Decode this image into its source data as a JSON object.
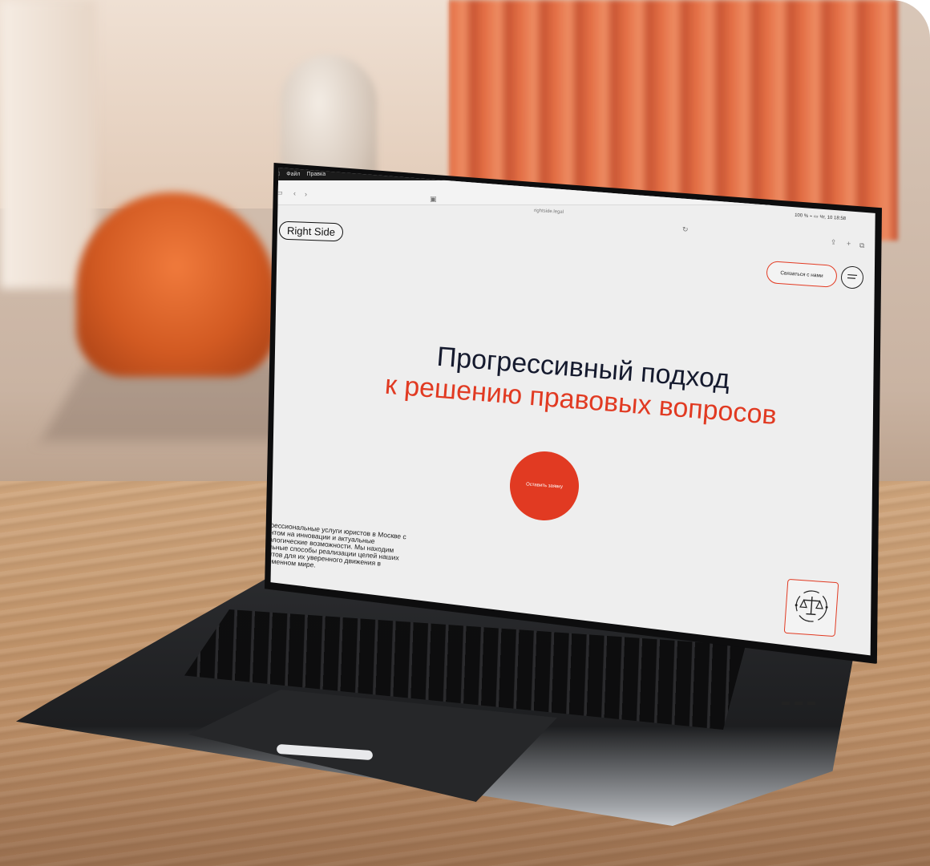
{
  "menubar": {
    "apple_icon": "apple-icon",
    "items": [
      "Файл",
      "Правка"
    ]
  },
  "browser": {
    "url": "rightside.legal",
    "status": "100 %  ⌁  ▭  Чт, 10  18:58"
  },
  "site": {
    "logo": "Right Side",
    "contact_button": "Связаться с нами",
    "menu_icon": "menu-icon",
    "headline_line1": "Прогрессивный подход",
    "headline_line2": "к решению правовых вопросов",
    "cta_label": "Оставить заявку",
    "description": "Профессиональные услуги юристов в Москве с акцентом на инновации и актуальные технологические возможности. Мы находим легальные способы реализации целей наших клиентов для их уверенного движения в современном мире.",
    "badge_icon": "scales-icon"
  },
  "colors": {
    "accent": "#e13a22",
    "headline_dark": "#151a2e",
    "screen_bg": "#eeeeee"
  }
}
